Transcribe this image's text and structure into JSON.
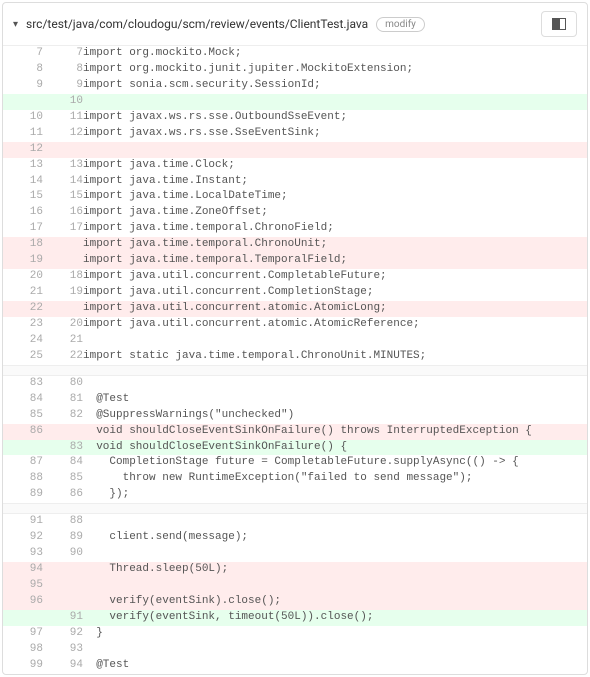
{
  "header": {
    "filepath": "src/test/java/com/cloudogu/scm/review/events/ClientTest.java",
    "badge": "modify"
  },
  "rows": [
    {
      "type": "ctx",
      "old": "7",
      "new": "7",
      "code": "import org.mockito.Mock;"
    },
    {
      "type": "ctx",
      "old": "8",
      "new": "8",
      "code": "import org.mockito.junit.jupiter.MockitoExtension;"
    },
    {
      "type": "ctx",
      "old": "9",
      "new": "9",
      "code": "import sonia.scm.security.SessionId;"
    },
    {
      "type": "add",
      "old": "",
      "new": "10",
      "code": ""
    },
    {
      "type": "ctx",
      "old": "10",
      "new": "11",
      "code": "import javax.ws.rs.sse.OutboundSseEvent;"
    },
    {
      "type": "ctx",
      "old": "11",
      "new": "12",
      "code": "import javax.ws.rs.sse.SseEventSink;"
    },
    {
      "type": "remove",
      "old": "12",
      "new": "",
      "code": ""
    },
    {
      "type": "ctx",
      "old": "13",
      "new": "13",
      "code": "import java.time.Clock;"
    },
    {
      "type": "ctx",
      "old": "14",
      "new": "14",
      "code": "import java.time.Instant;"
    },
    {
      "type": "ctx",
      "old": "15",
      "new": "15",
      "code": "import java.time.LocalDateTime;"
    },
    {
      "type": "ctx",
      "old": "16",
      "new": "16",
      "code": "import java.time.ZoneOffset;"
    },
    {
      "type": "ctx",
      "old": "17",
      "new": "17",
      "code": "import java.time.temporal.ChronoField;"
    },
    {
      "type": "remove",
      "old": "18",
      "new": "",
      "code": "import java.time.temporal.ChronoUnit;"
    },
    {
      "type": "remove",
      "old": "19",
      "new": "",
      "code": "import java.time.temporal.TemporalField;"
    },
    {
      "type": "ctx",
      "old": "20",
      "new": "18",
      "code": "import java.util.concurrent.CompletableFuture;"
    },
    {
      "type": "ctx",
      "old": "21",
      "new": "19",
      "code": "import java.util.concurrent.CompletionStage;"
    },
    {
      "type": "remove",
      "old": "22",
      "new": "",
      "code": "import java.util.concurrent.atomic.AtomicLong;"
    },
    {
      "type": "ctx",
      "old": "23",
      "new": "20",
      "code": "import java.util.concurrent.atomic.AtomicReference;"
    },
    {
      "type": "ctx",
      "old": "24",
      "new": "21",
      "code": ""
    },
    {
      "type": "ctx",
      "old": "25",
      "new": "22",
      "code": "import static java.time.temporal.ChronoUnit.MINUTES;"
    },
    {
      "type": "gap"
    },
    {
      "type": "ctx",
      "old": "83",
      "new": "80",
      "code": ""
    },
    {
      "type": "ctx",
      "old": "84",
      "new": "81",
      "code": "  @Test"
    },
    {
      "type": "ctx",
      "old": "85",
      "new": "82",
      "code": "  @SuppressWarnings(\"unchecked\")"
    },
    {
      "type": "remove",
      "old": "86",
      "new": "",
      "code": "  void shouldCloseEventSinkOnFailure() throws InterruptedException {"
    },
    {
      "type": "add",
      "old": "",
      "new": "83",
      "code": "  void shouldCloseEventSinkOnFailure() {"
    },
    {
      "type": "ctx",
      "old": "87",
      "new": "84",
      "code": "    CompletionStage future = CompletableFuture.supplyAsync(() -> {"
    },
    {
      "type": "ctx",
      "old": "88",
      "new": "85",
      "code": "      throw new RuntimeException(\"failed to send message\");"
    },
    {
      "type": "ctx",
      "old": "89",
      "new": "86",
      "code": "    });"
    },
    {
      "type": "gap"
    },
    {
      "type": "ctx",
      "old": "91",
      "new": "88",
      "code": ""
    },
    {
      "type": "ctx",
      "old": "92",
      "new": "89",
      "code": "    client.send(message);"
    },
    {
      "type": "ctx",
      "old": "93",
      "new": "90",
      "code": ""
    },
    {
      "type": "remove",
      "old": "94",
      "new": "",
      "code": "    Thread.sleep(50L);"
    },
    {
      "type": "remove",
      "old": "95",
      "new": "",
      "code": ""
    },
    {
      "type": "remove",
      "old": "96",
      "new": "",
      "code": "    verify(eventSink).close();"
    },
    {
      "type": "add",
      "old": "",
      "new": "91",
      "code": "    verify(eventSink, timeout(50L)).close();"
    },
    {
      "type": "ctx",
      "old": "97",
      "new": "92",
      "code": "  }"
    },
    {
      "type": "ctx",
      "old": "98",
      "new": "93",
      "code": ""
    },
    {
      "type": "ctx",
      "old": "99",
      "new": "94",
      "code": "  @Test"
    }
  ]
}
